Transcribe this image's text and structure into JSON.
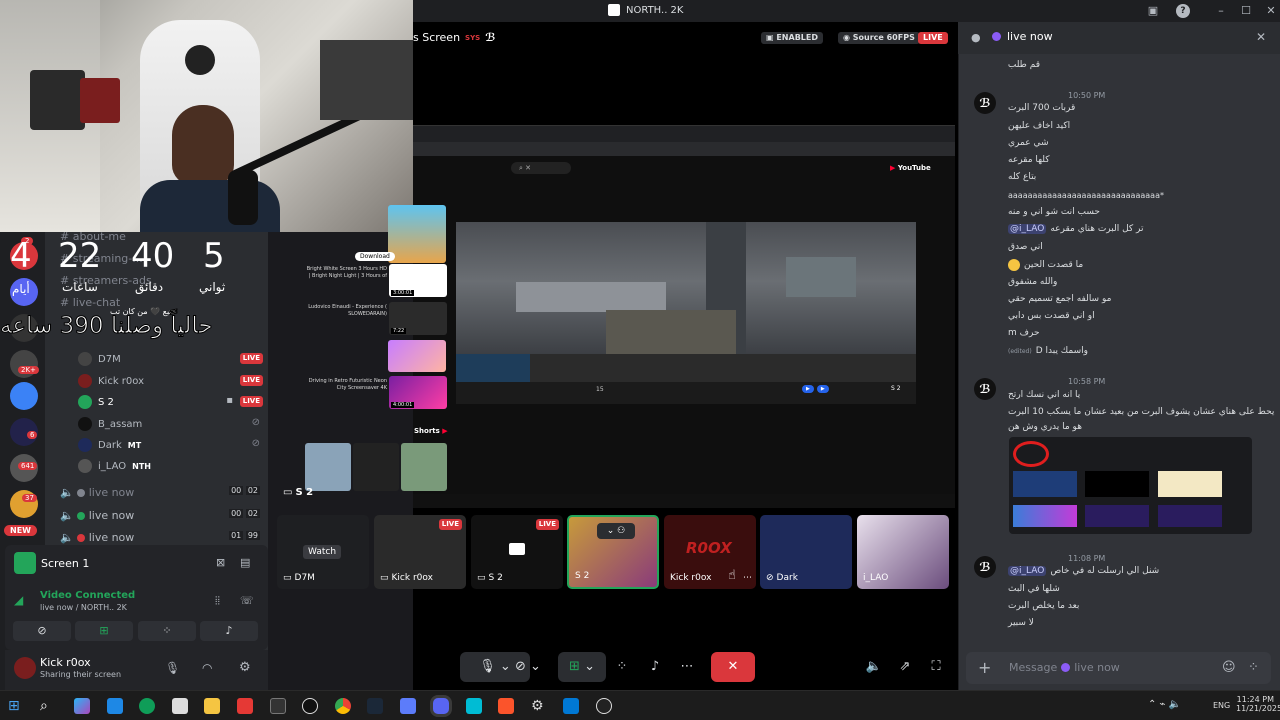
{
  "window": {
    "title": "NORTH.. 2K"
  },
  "stream": {
    "title_suffix": "s Screen",
    "enabled_label": "ENABLED",
    "source_label": "Source 60FPS",
    "live_label": "LIVE"
  },
  "webcam": {
    "countdown": {
      "days": "4",
      "hours": "22",
      "minutes": "40",
      "seconds": "5",
      "days_label": "أيام",
      "hours_label": "ساعات",
      "minutes_label": "دقائق",
      "seconds_label": "ثواني",
      "banner": "حالياً وصلنا 390 ساعه"
    },
    "sub_note": "متبع 🖤 من كان تب"
  },
  "sidebar": {
    "channels": [
      "about-me",
      "streaming-...",
      "streamers-ads",
      "live-chat"
    ],
    "voice_users": [
      {
        "name": "D7M",
        "live": true
      },
      {
        "name": "Kick r0ox",
        "live": true
      },
      {
        "name": "S 2",
        "live": true
      },
      {
        "name": "B_assam",
        "live": false
      },
      {
        "name": "Dark",
        "tag": "MT",
        "live": false
      },
      {
        "name": "i_LAO",
        "tag": "NTH",
        "live": false
      }
    ],
    "voice_channels": [
      {
        "name": "live now",
        "count_a": "00",
        "count_b": "02"
      },
      {
        "name": "live now",
        "count_a": "00",
        "count_b": "02"
      },
      {
        "name": "live now",
        "count_a": "01",
        "count_b": "99"
      }
    ],
    "server_badges": [
      "2",
      "2K+",
      "6",
      "641",
      "37",
      "NEW"
    ]
  },
  "voice_panel": {
    "screen_label": "Screen 1",
    "status": "Video Connected",
    "channel": "live now / NORTH.. 2K"
  },
  "user": {
    "name": "Kick r0ox",
    "status": "Sharing their screen"
  },
  "youtube": {
    "brand": "YouTube",
    "download_label": "Download",
    "shorts_label": "Shorts",
    "video_titles": [
      "Bright White Screen 3 Hours HD | Bright Night Light | 3 Hours of",
      "Ludovico Einaudi - Experience ( SLOWEDARAIN)",
      "Driving in Retro Futuristic Neon City Screensaver 4K"
    ],
    "durations": [
      "3:00:01",
      "7:22",
      "4:00:01"
    ],
    "channel_label": "S 2",
    "likes": "15"
  },
  "tiles": [
    {
      "name": "D7M",
      "label": "Watch",
      "live": false
    },
    {
      "name": "Kick r0ox",
      "live": true
    },
    {
      "name": "S 2",
      "live": true
    },
    {
      "name": "S 2",
      "live": false,
      "selected": true
    },
    {
      "name": "Kick r0ox",
      "live": false
    },
    {
      "name": "Dark",
      "live": false
    },
    {
      "name": "i_LAO",
      "live": false
    }
  ],
  "stream_overlay_name": "S 2",
  "chat": {
    "channel": "live now",
    "top_line": "قم طلب",
    "messages": [
      {
        "time": "10:50 PM",
        "lines": [
          "قربات 700 البرت",
          "اكيد اخاف عليهن",
          "شي عمري",
          "كلها مقرعه",
          "بتاع كله",
          "aaaaaaaaaaaaaaaaaaaaaaaaaaaaaaa*",
          "حسب انت شو اني و منه",
          "تر كل البرت هناي مقرعه",
          "اني صدق",
          "ما قصدت الحين",
          "والله مشفوق",
          "مو سالفه اجمع تسميم حقي",
          "او اني قصدت بس دابي",
          "حرف m",
          "واسمك يبدا D"
        ],
        "mention": "@i_LAO",
        "edited": "(edited)"
      },
      {
        "time": "10:58 PM",
        "lines": [
          "يا انه اني نسك ارتح",
          "يحط على هناي عشان يشوف البرت من بعيد عشان ما يسكب 10 البرت",
          "هو ما يدري وش هن"
        ]
      },
      {
        "time": "11:08 PM",
        "lines": [
          "شنل الي ارسلت له في خاص",
          "شلها في البث",
          "بعد ما يخلص البرت",
          "لا سبير"
        ],
        "mention": "@i_LAO"
      }
    ],
    "input_placeholder": "Message",
    "input_channel": "live now"
  },
  "taskbar": {
    "time": "11:24 PM",
    "date": "11/21/2025",
    "lang": "ENG"
  },
  "colors": {
    "discord_dark": "#1e1f22",
    "panel": "#2b2d31",
    "chat_bg": "#313338",
    "live_red": "#da373c",
    "green": "#23a55a",
    "blurple": "#5865f2"
  }
}
